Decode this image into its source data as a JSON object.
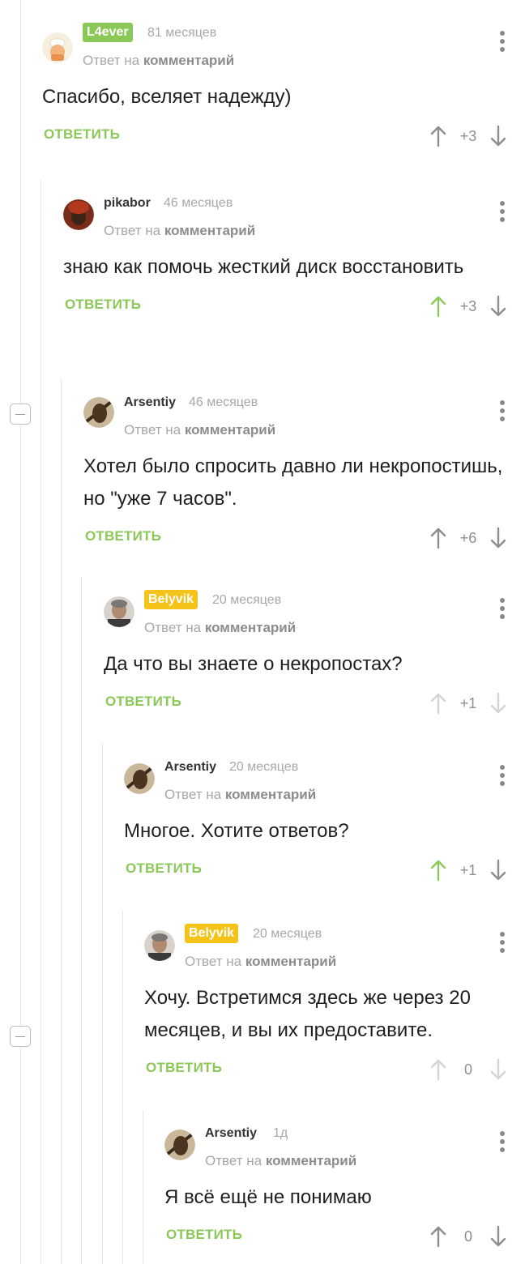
{
  "ui": {
    "reply_label": "ОТВЕТИТЬ",
    "reply_to_prefix": "Ответ на",
    "reply_to_target": "комментарий"
  },
  "colors": {
    "accent": "#8ac858",
    "badge_green": "#8ac858",
    "badge_yellow": "#f5c21a"
  },
  "comments": [
    {
      "author": "L4ever",
      "author_badge": "green",
      "time": "81 месяцев",
      "text": "Спасибо, вселяет надежду)",
      "rating": "+3",
      "upvoted": false,
      "avatar": "chef-avatar"
    },
    {
      "author": "pikabor",
      "author_badge": "none",
      "time": "46 месяцев",
      "text": "знаю как помочь жесткий диск восстановить",
      "rating": "+3",
      "upvoted": true,
      "avatar": "photo-avatar"
    },
    {
      "author": "Arsentiy",
      "author_badge": "none",
      "time": "46 месяцев",
      "text": "Хотел было спросить давно ли некропостишь, но \"уже 7 часов\".",
      "rating": "+6",
      "upvoted": false,
      "avatar": "dark-avatar"
    },
    {
      "author": "Belyvik",
      "author_badge": "yellow",
      "time": "20 месяцев",
      "text": "Да что вы знаете о некропостах?",
      "rating": "+1",
      "upvoted": false,
      "avatar": "portrait-avatar"
    },
    {
      "author": "Arsentiy",
      "author_badge": "none",
      "time": "20 месяцев",
      "text": "Многое. Хотите ответов?",
      "rating": "+1",
      "upvoted": true,
      "avatar": "dark-avatar"
    },
    {
      "author": "Belyvik",
      "author_badge": "yellow",
      "time": "20 месяцев",
      "text": "Хочу. Встретимся здесь же через 20 месяцев, и вы их предоставите.",
      "rating": "0",
      "upvoted": false,
      "avatar": "portrait-avatar"
    },
    {
      "author": "Arsentiy",
      "author_badge": "none",
      "time": "1д",
      "text": "Я всё ещё не понимаю",
      "rating": "0",
      "upvoted": false,
      "avatar": "dark-avatar"
    }
  ]
}
